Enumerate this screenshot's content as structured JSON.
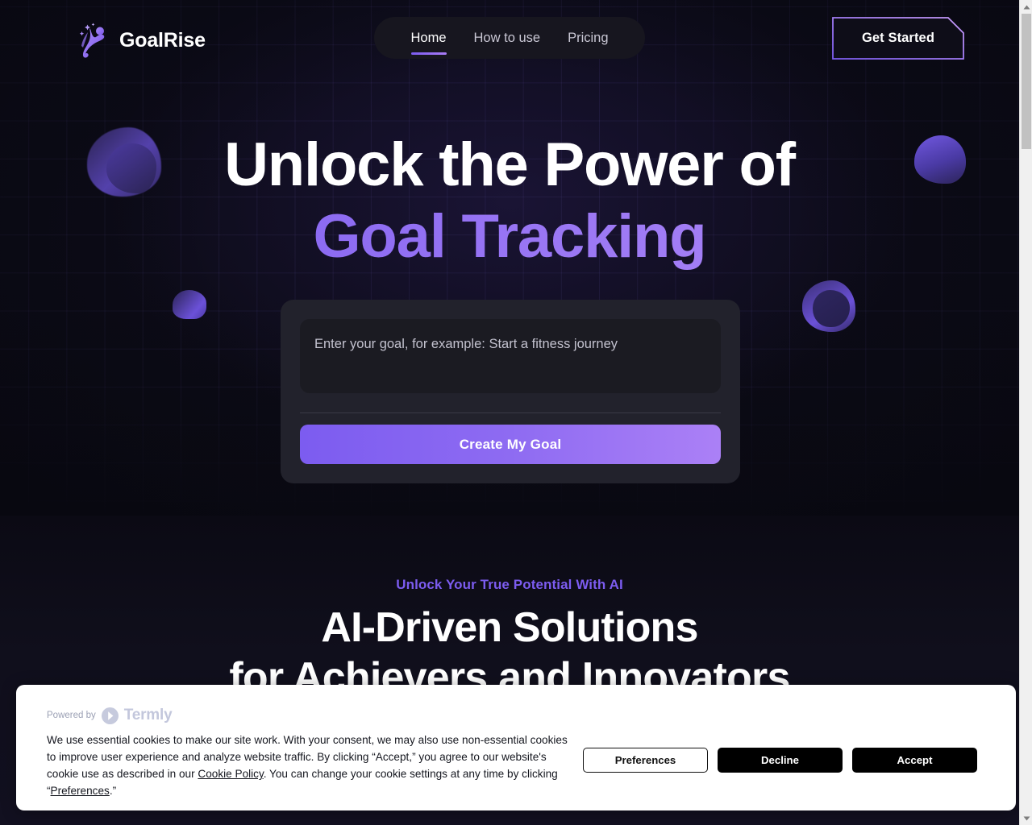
{
  "brand": {
    "name": "GoalRise",
    "logo_icon": "goalrise-star-figure-icon"
  },
  "nav": {
    "items": [
      {
        "label": "Home",
        "active": true
      },
      {
        "label": "How to use",
        "active": false
      },
      {
        "label": "Pricing",
        "active": false
      }
    ],
    "cta_label": "Get Started"
  },
  "hero": {
    "headline_line1": "Unlock the Power of",
    "headline_line2": "Goal Tracking",
    "goal_input": {
      "value": "",
      "placeholder": "Enter your goal, for example: Start a fitness journey"
    },
    "submit_label": "Create My Goal"
  },
  "section": {
    "eyebrow": "Unlock Your True Potential With AI",
    "title_line1": "AI-Driven Solutions",
    "title_line2": "for Achievers and Innovators"
  },
  "cookie_banner": {
    "powered_by_label": "Powered by",
    "provider_name": "Termly",
    "provider_icon": "termly-logo-icon",
    "body_part1": "We use essential cookies to make our site work. With your consent, we may also use non-essential cookies to improve user experience and analyze website traffic. By clicking “Accept,” you agree to our website's cookie use as described in our ",
    "link_cookie_policy": "Cookie Policy",
    "body_part2": ". You can change your cookie settings at any time by clicking “",
    "link_preferences": "Preferences",
    "body_part3": ".”",
    "buttons": {
      "preferences": "Preferences",
      "decline": "Decline",
      "accept": "Accept"
    }
  },
  "scrollbar": {
    "up_icon": "chevron-up-icon",
    "down_icon": "chevron-down-icon",
    "thumb": "scrollbar-thumb"
  },
  "colors": {
    "accent_purple": "#7c5cf0",
    "accent_purple_light": "#ab80f6",
    "page_background": "#0a0a14",
    "card_background": "#22222c",
    "input_background": "#1b1b22",
    "banner_background": "#ffffff"
  }
}
